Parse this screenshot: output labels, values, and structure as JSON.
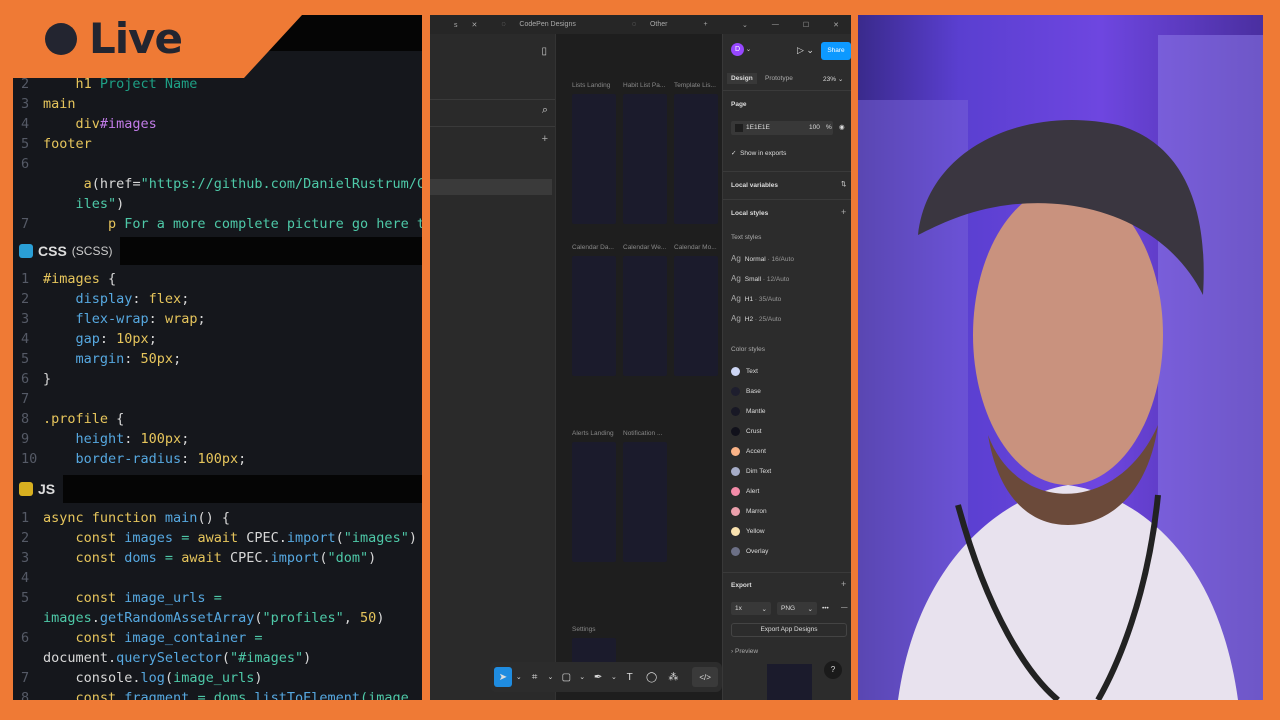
{
  "badge": {
    "label": "Live"
  },
  "editor": {
    "html_lines": [
      {
        "n": "2",
        "tokens": [
          {
            "t": "    h1 ",
            "c": "k"
          },
          {
            "t": "Project Name",
            "c": "d"
          }
        ]
      },
      {
        "n": "3",
        "tokens": [
          {
            "t": "main",
            "c": "k"
          }
        ]
      },
      {
        "n": "4",
        "tokens": [
          {
            "t": "    div",
            "c": "k"
          },
          {
            "t": "#images",
            "c": "p"
          }
        ]
      },
      {
        "n": "5",
        "tokens": [
          {
            "t": "footer",
            "c": "k"
          }
        ]
      },
      {
        "n": "6",
        "tokens": []
      },
      {
        "n": "",
        "tokens": [
          {
            "t": "     a",
            "c": "k"
          },
          {
            "t": "(",
            "c": "w"
          },
          {
            "t": "href",
            "c": "w"
          },
          {
            "t": "=",
            "c": "w"
          },
          {
            "t": "\"https://github.com/DanielRustrum/C",
            "c": "g"
          }
        ]
      },
      {
        "n": "",
        "tokens": [
          {
            "t": "    iles\"",
            "c": "g"
          },
          {
            "t": ")",
            "c": "w"
          }
        ]
      },
      {
        "n": "7",
        "tokens": [
          {
            "t": "        p ",
            "c": "k"
          },
          {
            "t": "For a more complete picture go here t",
            "c": "g"
          }
        ]
      }
    ],
    "css_tab": {
      "label": "CSS",
      "sub": "(SCSS)"
    },
    "css_lines": [
      {
        "n": "1",
        "tokens": [
          {
            "t": "#images ",
            "c": "k"
          },
          {
            "t": "{",
            "c": "w"
          }
        ]
      },
      {
        "n": "2",
        "tokens": [
          {
            "t": "    display",
            "c": "b"
          },
          {
            "t": ": ",
            "c": "w"
          },
          {
            "t": "flex",
            "c": "k"
          },
          {
            "t": ";",
            "c": "w"
          }
        ]
      },
      {
        "n": "3",
        "tokens": [
          {
            "t": "    flex-wrap",
            "c": "b"
          },
          {
            "t": ": ",
            "c": "w"
          },
          {
            "t": "wrap",
            "c": "k"
          },
          {
            "t": ";",
            "c": "w"
          }
        ]
      },
      {
        "n": "4",
        "tokens": [
          {
            "t": "    gap",
            "c": "b"
          },
          {
            "t": ": ",
            "c": "w"
          },
          {
            "t": "10px",
            "c": "k"
          },
          {
            "t": ";",
            "c": "w"
          }
        ]
      },
      {
        "n": "5",
        "tokens": [
          {
            "t": "    margin",
            "c": "b"
          },
          {
            "t": ": ",
            "c": "w"
          },
          {
            "t": "50px",
            "c": "k"
          },
          {
            "t": ";",
            "c": "w"
          }
        ]
      },
      {
        "n": "6",
        "tokens": [
          {
            "t": "}",
            "c": "w"
          }
        ]
      },
      {
        "n": "7",
        "tokens": []
      },
      {
        "n": "8",
        "tokens": [
          {
            "t": ".profile ",
            "c": "k"
          },
          {
            "t": "{",
            "c": "w"
          }
        ]
      },
      {
        "n": "9",
        "tokens": [
          {
            "t": "    height",
            "c": "b"
          },
          {
            "t": ": ",
            "c": "w"
          },
          {
            "t": "100px",
            "c": "k"
          },
          {
            "t": ";",
            "c": "w"
          }
        ]
      },
      {
        "n": "10",
        "tokens": [
          {
            "t": "    border-radius",
            "c": "b"
          },
          {
            "t": ": ",
            "c": "w"
          },
          {
            "t": "100px",
            "c": "k"
          },
          {
            "t": ";",
            "c": "w"
          }
        ]
      }
    ],
    "js_tab": {
      "label": "JS"
    },
    "js_lines": [
      {
        "n": "1",
        "tokens": [
          {
            "t": "async function ",
            "c": "k"
          },
          {
            "t": "main",
            "c": "b"
          },
          {
            "t": "() {",
            "c": "w"
          }
        ]
      },
      {
        "n": "2",
        "tokens": [
          {
            "t": "    const ",
            "c": "k"
          },
          {
            "t": "images",
            "c": "b"
          },
          {
            "t": " = ",
            "c": "g"
          },
          {
            "t": "await ",
            "c": "k"
          },
          {
            "t": "CPEC.",
            "c": "w"
          },
          {
            "t": "import",
            "c": "b"
          },
          {
            "t": "(",
            "c": "w"
          },
          {
            "t": "\"images\"",
            "c": "g"
          },
          {
            "t": ")",
            "c": "w"
          }
        ]
      },
      {
        "n": "3",
        "tokens": [
          {
            "t": "    const ",
            "c": "k"
          },
          {
            "t": "doms",
            "c": "b"
          },
          {
            "t": " = ",
            "c": "g"
          },
          {
            "t": "await ",
            "c": "k"
          },
          {
            "t": "CPEC.",
            "c": "w"
          },
          {
            "t": "import",
            "c": "b"
          },
          {
            "t": "(",
            "c": "w"
          },
          {
            "t": "\"dom\"",
            "c": "g"
          },
          {
            "t": ")",
            "c": "w"
          }
        ]
      },
      {
        "n": "4",
        "tokens": []
      },
      {
        "n": "5",
        "tokens": [
          {
            "t": "    const ",
            "c": "k"
          },
          {
            "t": "image_urls",
            "c": "b"
          },
          {
            "t": " =",
            "c": "g"
          }
        ]
      },
      {
        "n": "",
        "tokens": [
          {
            "t": "images",
            "c": "g"
          },
          {
            "t": ".",
            "c": "w"
          },
          {
            "t": "getRandomAssetArray",
            "c": "b"
          },
          {
            "t": "(",
            "c": "w"
          },
          {
            "t": "\"profiles\"",
            "c": "g"
          },
          {
            "t": ", ",
            "c": "w"
          },
          {
            "t": "50",
            "c": "k"
          },
          {
            "t": ")",
            "c": "w"
          }
        ]
      },
      {
        "n": "6",
        "tokens": [
          {
            "t": "    const ",
            "c": "k"
          },
          {
            "t": "image_container",
            "c": "b"
          },
          {
            "t": " =",
            "c": "g"
          }
        ]
      },
      {
        "n": "",
        "tokens": [
          {
            "t": "document.",
            "c": "w"
          },
          {
            "t": "querySelector",
            "c": "b"
          },
          {
            "t": "(",
            "c": "w"
          },
          {
            "t": "\"#images\"",
            "c": "g"
          },
          {
            "t": ")",
            "c": "w"
          }
        ]
      },
      {
        "n": "7",
        "tokens": [
          {
            "t": "    console.",
            "c": "w"
          },
          {
            "t": "log",
            "c": "b"
          },
          {
            "t": "(",
            "c": "w"
          },
          {
            "t": "image_urls",
            "c": "g"
          },
          {
            "t": ")",
            "c": "w"
          }
        ]
      },
      {
        "n": "8",
        "tokens": [
          {
            "t": "    const ",
            "c": "k"
          },
          {
            "t": "fragment",
            "c": "b"
          },
          {
            "t": " = ",
            "c": "g"
          },
          {
            "t": "doms.",
            "c": "g"
          },
          {
            "t": "listToElement",
            "c": "b"
          },
          {
            "t": "(image_",
            "c": "g"
          }
        ]
      }
    ]
  },
  "figma": {
    "tabs": [
      "s",
      "CodePen Designs",
      "Other"
    ],
    "frames": {
      "row1": [
        "Lists Landing",
        "Habit List Pa...",
        "Template Lis..."
      ],
      "row2": [
        "Calendar Da...",
        "Calendar We...",
        "Calendar Mo..."
      ],
      "row3": [
        "Alerts Landing",
        "Notification ..."
      ],
      "row4": [
        "Settings"
      ]
    },
    "panel": {
      "avatar": "D",
      "share": "Share",
      "tab_design": "Design",
      "tab_prototype": "Prototype",
      "zoom": "23%",
      "page_label": "Page",
      "page_color": "1E1E1E",
      "page_opacity": "100",
      "percent": "%",
      "show_exports": "Show in exports",
      "local_variables": "Local variables",
      "local_styles": "Local styles",
      "text_styles_label": "Text styles",
      "text_styles": [
        {
          "name": "Normal",
          "spec": " · 16/Auto"
        },
        {
          "name": "Small",
          "spec": " · 12/Auto"
        },
        {
          "name": "H1",
          "spec": " · 35/Auto"
        },
        {
          "name": "H2",
          "spec": " · 25/Auto"
        }
      ],
      "ag": "Ag",
      "color_styles_label": "Color styles",
      "color_styles": [
        {
          "name": "Text",
          "color": "#cdd6f4"
        },
        {
          "name": "Base",
          "color": "#1e1e2e"
        },
        {
          "name": "Mantle",
          "color": "#181825"
        },
        {
          "name": "Crust",
          "color": "#11111b"
        },
        {
          "name": "Accent",
          "color": "#fab387"
        },
        {
          "name": "Dim Text",
          "color": "#a6adc8"
        },
        {
          "name": "Alert",
          "color": "#f38ba8"
        },
        {
          "name": "Marron",
          "color": "#eba0ac"
        },
        {
          "name": "Yellow",
          "color": "#f9e2af"
        },
        {
          "name": "Overlay",
          "color": "#6c7086"
        }
      ],
      "export_label": "Export",
      "scale": "1x",
      "format": "PNG",
      "more": "•••",
      "export_button": "Export App Designs",
      "preview": "Preview",
      "help": "?"
    }
  }
}
